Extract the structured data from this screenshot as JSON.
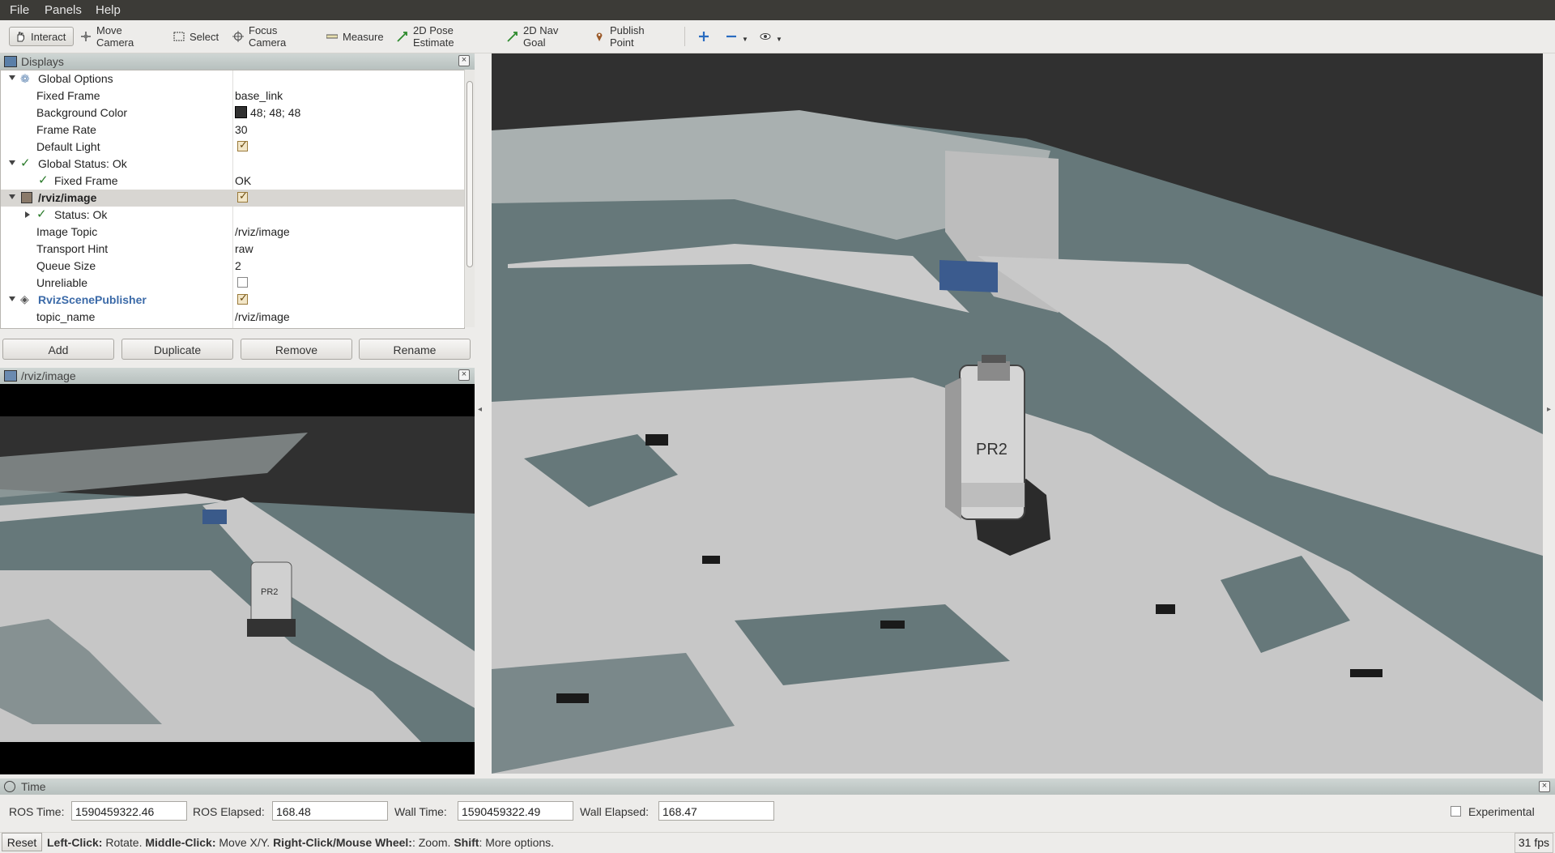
{
  "menu": [
    {
      "label": "File",
      "accel": "F"
    },
    {
      "label": "Panels",
      "accel": "P"
    },
    {
      "label": "Help",
      "accel": "H"
    }
  ],
  "toolbar": {
    "interact": "Interact",
    "move_camera": "Move Camera",
    "select": "Select",
    "focus_camera": "Focus Camera",
    "measure": "Measure",
    "pose_estimate": "2D Pose Estimate",
    "nav_goal": "2D Nav Goal",
    "publish_point": "Publish Point"
  },
  "displays": {
    "title": "Displays",
    "rows": {
      "global_options": "Global Options",
      "fixed_frame": {
        "name": "Fixed Frame",
        "value": "base_link"
      },
      "background_color": {
        "name": "Background Color",
        "value": "48; 48; 48",
        "color": "#303030"
      },
      "frame_rate": {
        "name": "Frame Rate",
        "value": "30"
      },
      "default_light": {
        "name": "Default Light",
        "checked": true
      },
      "global_status": "Global Status: Ok",
      "fixed_frame_status": {
        "name": "Fixed Frame",
        "value": "OK"
      },
      "rviz_image": {
        "name": "/rviz/image",
        "checked": true
      },
      "status": "Status: Ok",
      "image_topic": {
        "name": "Image Topic",
        "value": "/rviz/image"
      },
      "transport_hint": {
        "name": "Transport Hint",
        "value": "raw"
      },
      "queue_size": {
        "name": "Queue Size",
        "value": "2"
      },
      "unreliable": {
        "name": "Unreliable",
        "checked": false
      },
      "scene_publisher": {
        "name": "RvizScenePublisher",
        "checked": true
      },
      "topic_name": {
        "name": "topic_name",
        "value": "/rviz/image"
      }
    }
  },
  "buttons": {
    "add": "Add",
    "duplicate": "Duplicate",
    "remove": "Remove",
    "rename": "Rename"
  },
  "image_panel": {
    "title": "/rviz/image"
  },
  "robot_label": "PR2",
  "time": {
    "title": "Time",
    "ros_time_label": "ROS Time:",
    "ros_time": "1590459322.46",
    "ros_elapsed_label": "ROS Elapsed:",
    "ros_elapsed": "168.48",
    "wall_time_label": "Wall Time:",
    "wall_time": "1590459322.49",
    "wall_elapsed_label": "Wall Elapsed:",
    "wall_elapsed": "168.47",
    "experimental": "Experimental"
  },
  "status": {
    "reset": "Reset",
    "left_click": "Left-Click:",
    "left_desc": " Rotate. ",
    "middle_click": "Middle-Click:",
    "middle_desc": " Move X/Y. ",
    "right_click": "Right-Click/Mouse Wheel:",
    "right_desc": ": Zoom. ",
    "shift": "Shift",
    "shift_desc": ": More options.",
    "fps": "31 fps"
  }
}
